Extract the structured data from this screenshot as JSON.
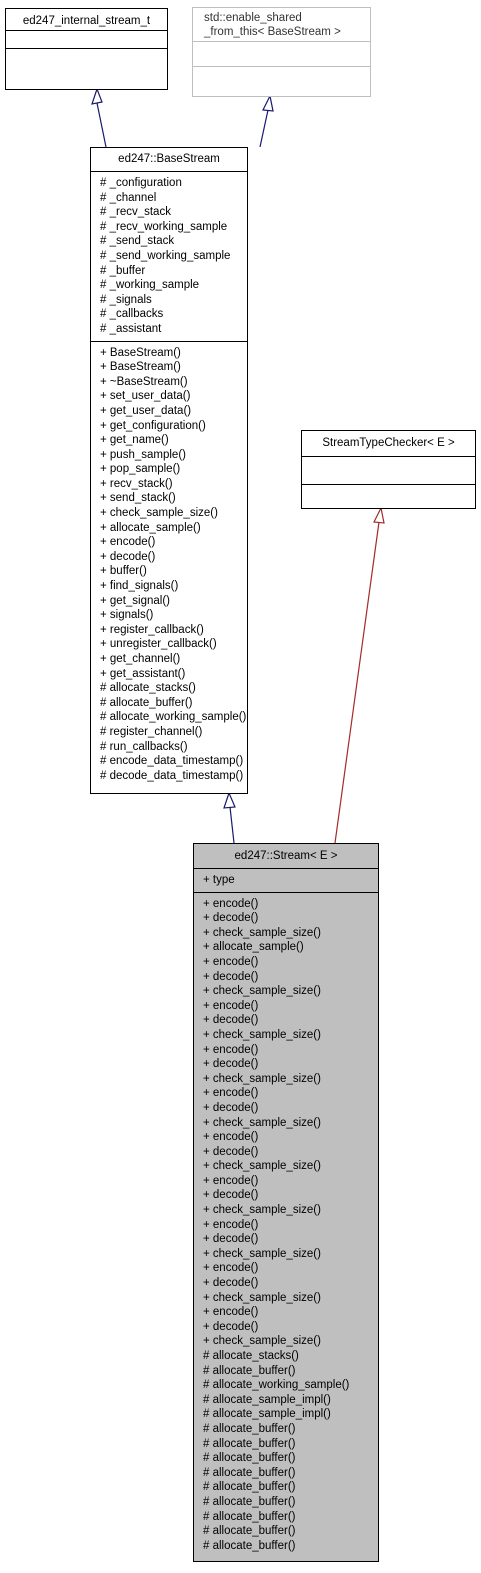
{
  "classes": {
    "internal": {
      "title": "ed247_internal_stream_t"
    },
    "enable_shared": {
      "title_line1": "std::enable_shared",
      "title_line2": "_from_this< BaseStream >"
    },
    "base": {
      "title": "ed247::BaseStream",
      "attributes": [
        "# _configuration",
        "# _channel",
        "# _recv_stack",
        "# _recv_working_sample",
        "# _send_stack",
        "# _send_working_sample",
        "# _buffer",
        "# _working_sample",
        "# _signals",
        "# _callbacks",
        "# _assistant"
      ],
      "methods": [
        "+ BaseStream()",
        "+ BaseStream()",
        "+ ~BaseStream()",
        "+ set_user_data()",
        "+ get_user_data()",
        "+ get_configuration()",
        "+ get_name()",
        "+ push_sample()",
        "+ pop_sample()",
        "+ recv_stack()",
        "+ send_stack()",
        "+ check_sample_size()",
        "+ allocate_sample()",
        "+ encode()",
        "+ decode()",
        "+ buffer()",
        "+ find_signals()",
        "+ get_signal()",
        "+ signals()",
        "+ register_callback()",
        "+ unregister_callback()",
        "+ get_channel()",
        "+ get_assistant()",
        "# allocate_stacks()",
        "# allocate_buffer()",
        "# allocate_working_sample()",
        "# register_channel()",
        "# run_callbacks()",
        "# encode_data_timestamp()",
        "# decode_data_timestamp()"
      ]
    },
    "checker": {
      "title": "StreamTypeChecker< E >"
    },
    "stream": {
      "title": "ed247::Stream< E >",
      "attributes": [
        "+ type"
      ],
      "methods": [
        "+ encode()",
        "+ decode()",
        "+ check_sample_size()",
        "+ allocate_sample()",
        "+ encode()",
        "+ decode()",
        "+ check_sample_size()",
        "+ encode()",
        "+ decode()",
        "+ check_sample_size()",
        "+ encode()",
        "+ decode()",
        "+ check_sample_size()",
        "+ encode()",
        "+ decode()",
        "+ check_sample_size()",
        "+ encode()",
        "+ decode()",
        "+ check_sample_size()",
        "+ encode()",
        "+ decode()",
        "+ check_sample_size()",
        "+ encode()",
        "+ decode()",
        "+ check_sample_size()",
        "+ encode()",
        "+ decode()",
        "+ check_sample_size()",
        "+ encode()",
        "+ decode()",
        "+ check_sample_size()",
        "# allocate_stacks()",
        "# allocate_buffer()",
        "# allocate_working_sample()",
        "# allocate_sample_impl()",
        "# allocate_sample_impl()",
        "# allocate_buffer()",
        "# allocate_buffer()",
        "# allocate_buffer()",
        "# allocate_buffer()",
        "# allocate_buffer()",
        "# allocate_buffer()",
        "# allocate_buffer()",
        "# allocate_buffer()",
        "# allocate_buffer()"
      ]
    }
  },
  "colors": {
    "inheritance_edge": "#191970",
    "template_edge": "#a52a2a",
    "highlight_fill": "#bfbfbf",
    "muted_border": "#bfbfbf"
  }
}
